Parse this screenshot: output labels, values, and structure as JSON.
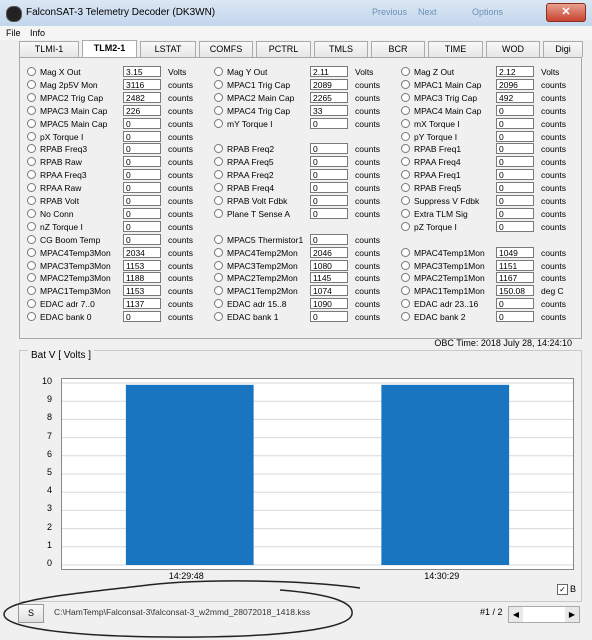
{
  "window": {
    "title": "FalconSAT-3 Telemetry Decoder (DK3WN)",
    "ghost_previous": "Previous",
    "ghost_next": "Next",
    "ghost_options": "Options",
    "close_glyph": "✕"
  },
  "menu": [
    "File",
    "Info"
  ],
  "tabs": [
    "TLMI-1",
    "TLM2-1",
    "LSTAT",
    "COMFS",
    "PCTRL",
    "TMLS",
    "BCR",
    "TIME",
    "WOD",
    "Digi"
  ],
  "active_tab": "TLM2-1",
  "telemetry": {
    "col1": [
      {
        "label": "Mag X Out",
        "value": "3.15",
        "unit": "Volts"
      },
      {
        "label": "Mag 2p5V Mon",
        "value": "3116",
        "unit": "counts"
      },
      {
        "label": "MPAC2 Trig Cap",
        "value": "2482",
        "unit": "counts"
      },
      {
        "label": "MPAC3 Main Cap",
        "value": "226",
        "unit": "counts"
      },
      {
        "label": "MPAC5 Main Cap",
        "value": "0",
        "unit": "counts"
      },
      {
        "label": "pX Torque I",
        "value": "0",
        "unit": "counts"
      },
      {
        "label": "RPAB Freq3",
        "value": "0",
        "unit": "counts"
      },
      {
        "label": "RPAB Raw",
        "value": "0",
        "unit": "counts"
      },
      {
        "label": "RPAA Freq3",
        "value": "0",
        "unit": "counts"
      },
      {
        "label": "RPAA Raw",
        "value": "0",
        "unit": "counts"
      },
      {
        "label": "RPAB Volt",
        "value": "0",
        "unit": "counts"
      },
      {
        "label": "No Conn",
        "value": "0",
        "unit": "counts"
      },
      {
        "label": "nZ Torque I",
        "value": "0",
        "unit": "counts"
      },
      {
        "label": "CG Boom Temp",
        "value": "0",
        "unit": "counts"
      },
      {
        "label": "MPAC4Temp3Mon",
        "value": "2034",
        "unit": "counts"
      },
      {
        "label": "MPAC3Temp3Mon",
        "value": "1153",
        "unit": "counts"
      },
      {
        "label": "MPAC2Temp3Mon",
        "value": "1188",
        "unit": "counts"
      },
      {
        "label": "MPAC1Temp3Mon",
        "value": "1153",
        "unit": "counts"
      },
      {
        "label": "EDAC adr 7..0",
        "value": "1137",
        "unit": "counts"
      },
      {
        "label": "EDAC bank 0",
        "value": "0",
        "unit": "counts"
      }
    ],
    "col2": [
      {
        "label": "Mag Y Out",
        "value": "2.11",
        "unit": "Volts",
        "row": 0
      },
      {
        "label": "MPAC1 Trig Cap",
        "value": "2089",
        "unit": "counts",
        "row": 1
      },
      {
        "label": "MPAC2 Main Cap",
        "value": "2265",
        "unit": "counts",
        "row": 2
      },
      {
        "label": "MPAC4 Trig Cap",
        "value": "33",
        "unit": "counts",
        "row": 3
      },
      {
        "label": "mY Torque I",
        "value": "0",
        "unit": "counts",
        "row": 4
      },
      {
        "label": "RPAB Freq2",
        "value": "0",
        "unit": "counts",
        "row": 6
      },
      {
        "label": "RPAA Freq5",
        "value": "0",
        "unit": "counts",
        "row": 7
      },
      {
        "label": "RPAA Freq2",
        "value": "0",
        "unit": "counts",
        "row": 8
      },
      {
        "label": "RPAB Freq4",
        "value": "0",
        "unit": "counts",
        "row": 9
      },
      {
        "label": "RPAB Volt Fdbk",
        "value": "0",
        "unit": "counts",
        "row": 10
      },
      {
        "label": "Plane T Sense A",
        "value": "0",
        "unit": "counts",
        "row": 11
      },
      {
        "label": "MPAC5 Thermistor1",
        "value": "0",
        "unit": "counts",
        "row": 13
      },
      {
        "label": "MPAC4Temp2Mon",
        "value": "2046",
        "unit": "counts",
        "row": 14
      },
      {
        "label": "MPAC3Temp2Mon",
        "value": "1080",
        "unit": "counts",
        "row": 15
      },
      {
        "label": "MPAC2Temp2Mon",
        "value": "1145",
        "unit": "counts",
        "row": 16
      },
      {
        "label": "MPAC1Temp2Mon",
        "value": "1074",
        "unit": "counts",
        "row": 17
      },
      {
        "label": "EDAC adr 15..8",
        "value": "1090",
        "unit": "counts",
        "row": 18
      },
      {
        "label": "EDAC bank 1",
        "value": "0",
        "unit": "counts",
        "row": 19
      }
    ],
    "col3": [
      {
        "label": "Mag Z Out",
        "value": "2.12",
        "unit": "Volts",
        "row": 0
      },
      {
        "label": "MPAC1 Main Cap",
        "value": "2096",
        "unit": "counts",
        "row": 1
      },
      {
        "label": "MPAC3 Trig Cap",
        "value": "492",
        "unit": "counts",
        "row": 2
      },
      {
        "label": "MPAC4 Main Cap",
        "value": "0",
        "unit": "counts",
        "row": 3
      },
      {
        "label": "mX Torque I",
        "value": "0",
        "unit": "counts",
        "row": 4
      },
      {
        "label": "pY Torque I",
        "value": "0",
        "unit": "counts",
        "row": 5
      },
      {
        "label": "RPAB Freq1",
        "value": "0",
        "unit": "counts",
        "row": 6
      },
      {
        "label": "RPAA Freq4",
        "value": "0",
        "unit": "counts",
        "row": 7
      },
      {
        "label": "RPAA Freq1",
        "value": "0",
        "unit": "counts",
        "row": 8
      },
      {
        "label": "RPAB Freq5",
        "value": "0",
        "unit": "counts",
        "row": 9
      },
      {
        "label": "Suppress V Fdbk",
        "value": "0",
        "unit": "counts",
        "row": 10
      },
      {
        "label": "Extra TLM Sig",
        "value": "0",
        "unit": "counts",
        "row": 11
      },
      {
        "label": "pZ Torque I",
        "value": "0",
        "unit": "counts",
        "row": 12
      },
      {
        "label": "MPAC4Temp1Mon",
        "value": "1049",
        "unit": "counts",
        "row": 14
      },
      {
        "label": "MPAC3Temp1Mon",
        "value": "1151",
        "unit": "counts",
        "row": 15
      },
      {
        "label": "MPAC2Temp1Mon",
        "value": "1167",
        "unit": "counts",
        "row": 16
      },
      {
        "label": "MPAC1Temp1Mon",
        "value": "150.08",
        "unit": "deg C",
        "row": 17
      },
      {
        "label": "EDAC adr 23..16",
        "value": "0",
        "unit": "counts",
        "row": 18
      },
      {
        "label": "EDAC bank 2",
        "value": "0",
        "unit": "counts",
        "row": 19
      }
    ]
  },
  "obc_time": "OBC Time: 2018 July 28, 14:24:10",
  "chart_title": "Bat V  [ Volts ]",
  "chart_data": {
    "type": "bar",
    "title": "Bat V  [ Volts ]",
    "categories": [
      "14:29:48",
      "14:30:29"
    ],
    "values": [
      9.9,
      9.9
    ],
    "ylim": [
      0,
      10
    ],
    "yticks": [
      0,
      1,
      2,
      3,
      4,
      5,
      6,
      7,
      8,
      9,
      10
    ],
    "bar_color": "#1a75c0",
    "grid": true
  },
  "checkbox": {
    "label": "B",
    "checked": true
  },
  "status": {
    "button_label": "S",
    "file_path": "C:\\HamTemp\\Falconsat-3\\falconsat-3_w2mmd_28072018_1418.kss",
    "page": "#1 / 2"
  }
}
